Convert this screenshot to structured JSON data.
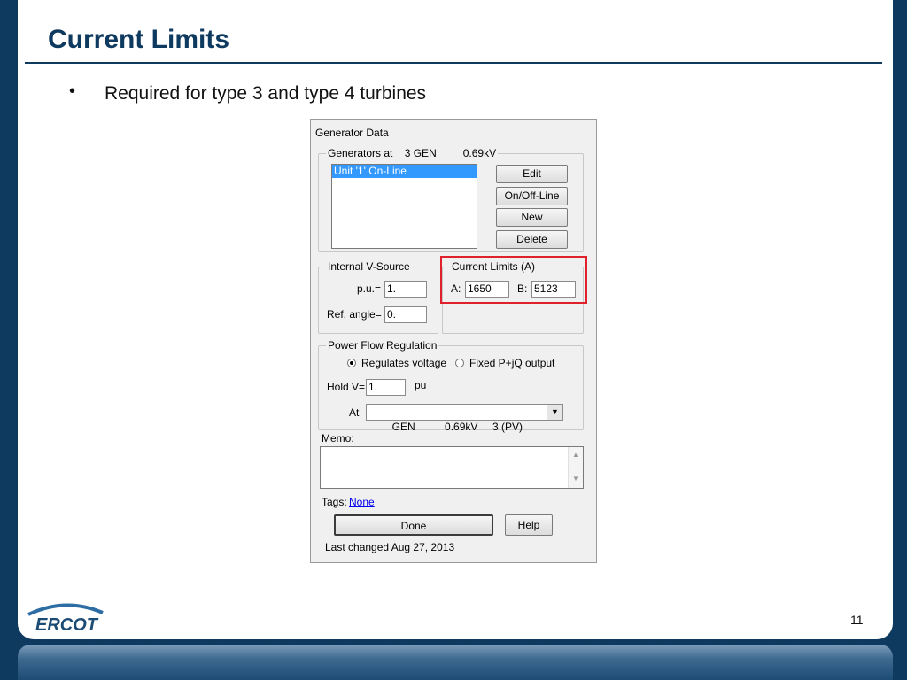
{
  "slide": {
    "title": "Current Limits",
    "bullet": "Required for type 3 and type 4 turbines",
    "page_number": "11",
    "logo_text": "ERCOT"
  },
  "dialog": {
    "title": "Generator Data",
    "generators_group": {
      "label_prefix": "Generators at",
      "bus": "3 GEN",
      "voltage": "0.69kV",
      "list_items": [
        "Unit '1'  On-Line"
      ],
      "buttons": {
        "edit": "Edit",
        "on_off_line": "On/Off-Line",
        "new": "New",
        "delete": "Delete"
      }
    },
    "internal_v_source": {
      "label": "Internal V-Source",
      "pu_label": "p.u.=",
      "pu_value": "1.",
      "ref_angle_label": "Ref. angle=",
      "ref_angle_value": "0."
    },
    "current_limits": {
      "label": "Current Limits (A)",
      "a_label": "A:",
      "a_value": "1650",
      "b_label": "B:",
      "b_value": "5123"
    },
    "power_flow": {
      "label": "Power Flow Regulation",
      "option_voltage": "Regulates voltage",
      "option_fixed": "Fixed P+jQ output",
      "selected": "Regulates voltage",
      "hold_v_label": "Hold V=",
      "hold_v_value": "1.",
      "hold_v_unit": "pu",
      "at_label": "At",
      "at_select": "GEN          0.69kV     3 (PV)"
    },
    "memo_label": "Memo:",
    "memo_value": "",
    "tags_label": "Tags:",
    "tags_value": "None",
    "done_button": "Done",
    "help_button": "Help",
    "last_changed": "Last changed Aug 27, 2013"
  },
  "colors": {
    "slide_bg": "#0f3a5f",
    "title": "#0f3a5f",
    "highlight": "#e0202a",
    "selection": "#3399ff"
  }
}
